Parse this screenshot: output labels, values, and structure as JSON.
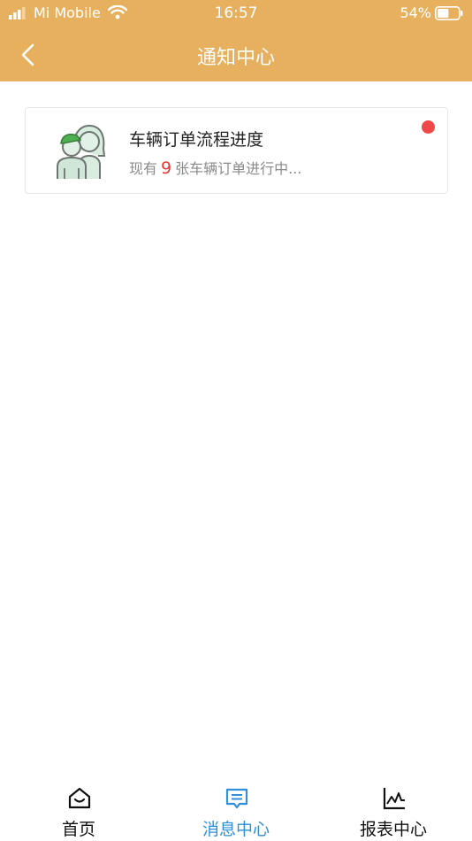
{
  "status_bar": {
    "carrier": "Mi Mobile",
    "time": "16:57",
    "battery": "54%",
    "battery_level": 0.54
  },
  "header": {
    "title": "通知中心",
    "back_icon": "chevron-left-icon"
  },
  "notifications": [
    {
      "title": "车辆订单流程进度",
      "prefix": "现有",
      "count": "9",
      "suffix": "张车辆订单进行中...",
      "unread": true,
      "avatar_icon": "users-icon"
    }
  ],
  "tabbar": {
    "items": [
      {
        "label": "首页",
        "icon": "home-icon",
        "active": false
      },
      {
        "label": "消息中心",
        "icon": "message-icon",
        "active": true
      },
      {
        "label": "报表中心",
        "icon": "chart-icon",
        "active": false
      }
    ]
  },
  "colors": {
    "header": "#E6B05E",
    "active_tab": "#2F8FD8",
    "badge": "#F04848",
    "count": "#e53935"
  }
}
